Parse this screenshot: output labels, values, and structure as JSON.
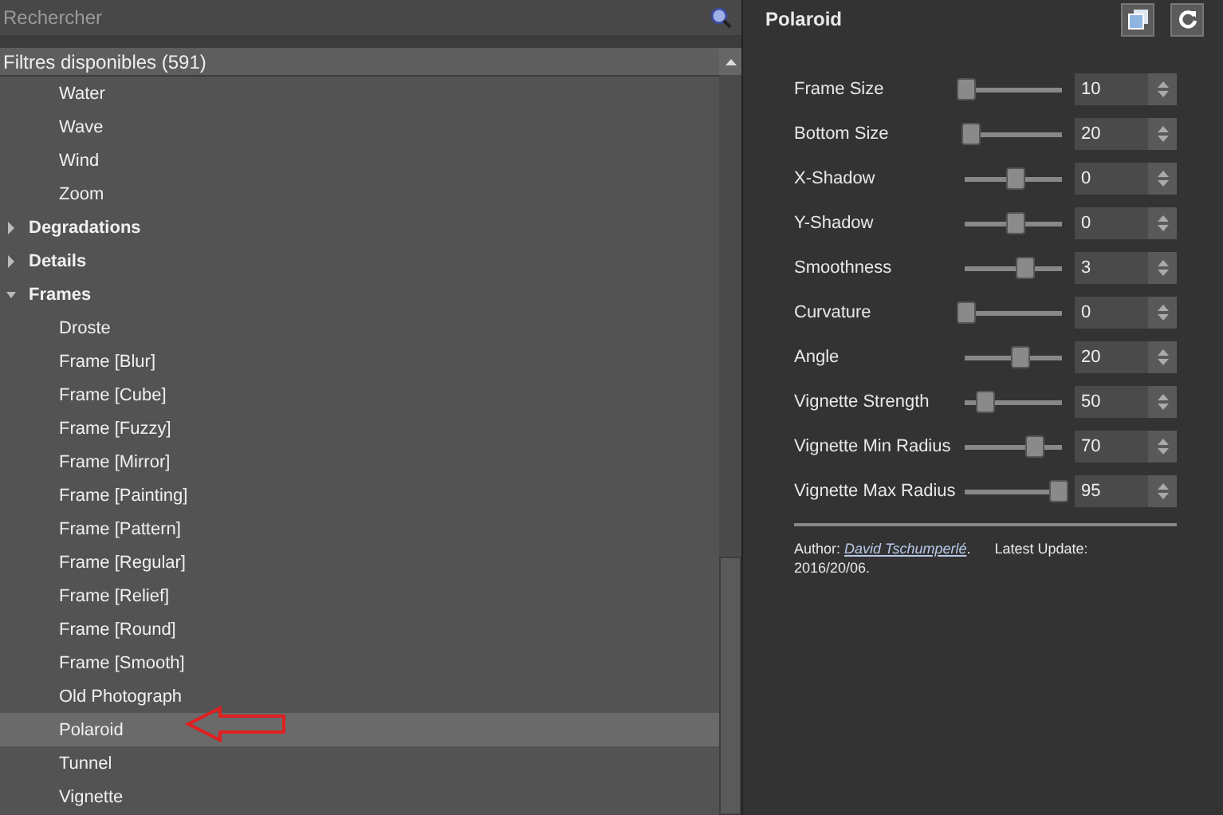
{
  "search": {
    "placeholder": "Rechercher"
  },
  "filter_list": {
    "header": "Filtres disponibles (591)",
    "items": [
      {
        "label": "Water",
        "selected": false
      },
      {
        "label": "Wave",
        "selected": false
      },
      {
        "label": "Wind",
        "selected": false
      },
      {
        "label": "Zoom",
        "selected": false
      },
      {
        "label": "Degradations",
        "kind": "category",
        "expanded": false
      },
      {
        "label": "Details",
        "kind": "category",
        "expanded": false
      },
      {
        "label": "Frames",
        "kind": "category",
        "expanded": true,
        "children": [
          {
            "label": "Droste",
            "selected": false
          },
          {
            "label": "Frame [Blur]",
            "selected": false
          },
          {
            "label": "Frame [Cube]",
            "selected": false
          },
          {
            "label": "Frame [Fuzzy]",
            "selected": false
          },
          {
            "label": "Frame [Mirror]",
            "selected": false
          },
          {
            "label": "Frame [Painting]",
            "selected": false
          },
          {
            "label": "Frame [Pattern]",
            "selected": false
          },
          {
            "label": "Frame [Regular]",
            "selected": false
          },
          {
            "label": "Frame [Relief]",
            "selected": false
          },
          {
            "label": "Frame [Round]",
            "selected": false
          },
          {
            "label": "Frame [Smooth]",
            "selected": false
          },
          {
            "label": "Old Photograph",
            "selected": false
          },
          {
            "label": "Polaroid",
            "selected": true
          },
          {
            "label": "Tunnel",
            "selected": false
          },
          {
            "label": "Vignette",
            "selected": false
          }
        ]
      }
    ]
  },
  "settings": {
    "title": "Polaroid",
    "params": [
      {
        "name": "Frame Size",
        "level": 0,
        "value": "10"
      },
      {
        "name": "Bottom Size",
        "level": 0.05,
        "value": "20"
      },
      {
        "name": "X-Shadow",
        "level": 0.5,
        "value": "0"
      },
      {
        "name": "Y-Shadow",
        "level": 0.5,
        "value": "0"
      },
      {
        "name": "Smoothness",
        "level": 0.6,
        "value": "3"
      },
      {
        "name": "Curvature",
        "level": 0,
        "value": "0"
      },
      {
        "name": "Angle",
        "level": 0.55,
        "value": "20"
      },
      {
        "name": "Vignette Strength",
        "level": 0.2,
        "value": "50"
      },
      {
        "name": "Vignette Min Radius",
        "level": 0.7,
        "value": "70"
      },
      {
        "name": "Vignette Max Radius",
        "level": 0.95,
        "value": "95"
      }
    ],
    "footer": {
      "prefix": "Author:",
      "link": "David Tschumperlé",
      "suffix": ".      Latest Update: 2016/20/06."
    }
  }
}
